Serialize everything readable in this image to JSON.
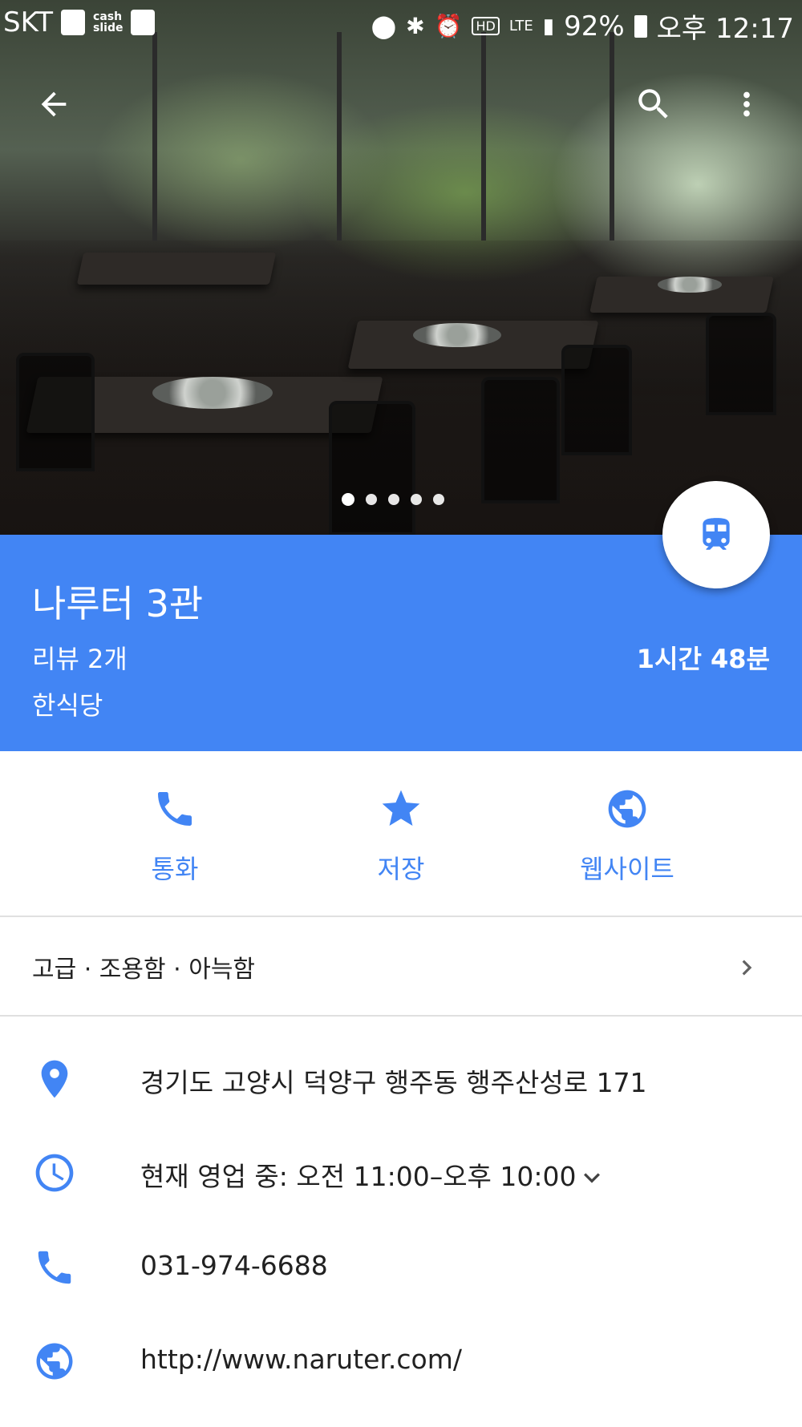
{
  "status_bar": {
    "carrier": "SKT",
    "cash_slide": "cash\nslide",
    "battery": "92%",
    "time": "오후 12:17",
    "hd_voice": "HD",
    "network": "LTE"
  },
  "hero": {
    "photo_count": 5,
    "active_photo": 1
  },
  "place": {
    "name": "나루터 3관",
    "reviews": "리뷰 2개",
    "category": "한식당",
    "duration": "1시간 48분"
  },
  "actions": {
    "call": "통화",
    "save": "저장",
    "website": "웹사이트"
  },
  "attributes": "고급 · 조용함 · 아늑함",
  "details": {
    "address": "경기도 고양시 덕양구 행주동 행주산성로 171",
    "hours": "현재 영업 중: 오전 11:00–오후 10:00",
    "phone": "031-974-6688",
    "website": "http://www.naruter.com/"
  },
  "colors": {
    "primary": "#4285f4",
    "text": "#212121",
    "divider": "#e0e0e0"
  },
  "icons": [
    "back-arrow-icon",
    "search-icon",
    "more-vert-icon",
    "train-icon",
    "phone-icon",
    "star-icon",
    "globe-icon",
    "chevron-right-icon",
    "location-pin-icon",
    "clock-icon",
    "chevron-down-icon"
  ]
}
